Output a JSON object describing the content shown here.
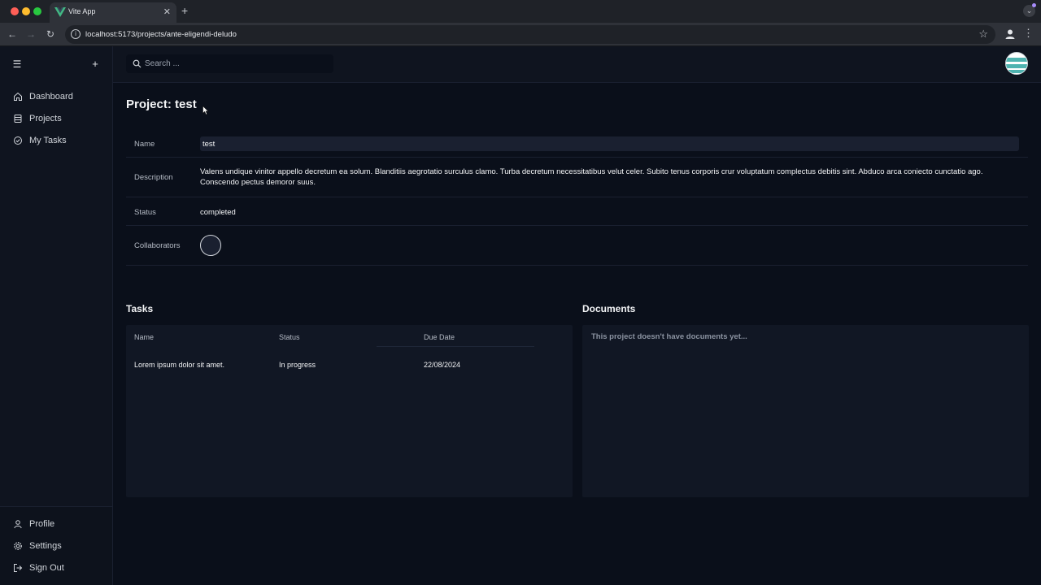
{
  "browser": {
    "tab_title": "Vite App",
    "url": "localhost:5173/projects/ante-eligendi-deludo"
  },
  "search": {
    "placeholder": "Search ..."
  },
  "sidebar": {
    "nav": [
      {
        "label": "Dashboard",
        "icon": "home-icon"
      },
      {
        "label": "Projects",
        "icon": "projects-icon"
      },
      {
        "label": "My Tasks",
        "icon": "tasks-icon"
      }
    ],
    "bottom": [
      {
        "label": "Profile",
        "icon": "user-icon"
      },
      {
        "label": "Settings",
        "icon": "gear-icon"
      },
      {
        "label": "Sign Out",
        "icon": "sign-out-icon"
      }
    ]
  },
  "project": {
    "title": "Project: test",
    "fields": {
      "name_label": "Name",
      "name_value": "test",
      "description_label": "Description",
      "description_value": "Valens undique vinitor appello decretum ea solum. Blanditiis aegrotatio surculus clamo. Turba decretum necessitatibus velut celer. Subito tenus corporis crur voluptatum complectus debitis sint. Abduco arca coniecto cunctatio ago. Conscendo pectus demoror suus.",
      "status_label": "Status",
      "status_value": "completed",
      "collaborators_label": "Collaborators"
    }
  },
  "tasks": {
    "title": "Tasks",
    "columns": [
      "Name",
      "Status",
      "Due Date"
    ],
    "rows": [
      {
        "name": "Lorem ipsum dolor sit amet.",
        "status": "In progress",
        "due": "22/08/2024"
      }
    ]
  },
  "documents": {
    "title": "Documents",
    "empty": "This project doesn't have documents yet..."
  },
  "colors": {
    "background": "#0a0f1a",
    "sidebar": "#0f141f",
    "panel": "#111724",
    "vite_green": "#42b883"
  }
}
